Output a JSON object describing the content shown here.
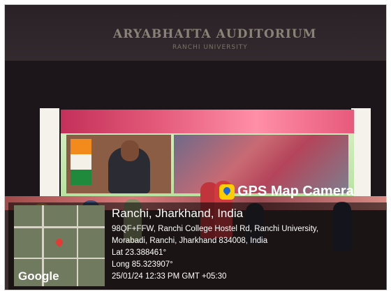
{
  "scene": {
    "wall_title": "ARYABHATTA AUDITORIUM",
    "wall_subtitle": "RANCHI UNIVERSITY"
  },
  "watermark": {
    "app_name": "GPS Map Camera",
    "map_logo": "Google",
    "location_title": "Ranchi, Jharkhand, India",
    "address_line1": "98QF+FFW, Ranchi College Hostel Rd, Ranchi University,",
    "address_line2": "Morabadi, Ranchi, Jharkhand 834008, India",
    "lat": "Lat 23.388461°",
    "long": "Long 85.323907°",
    "datetime": "25/01/24 12:33 PM GMT +05:30"
  }
}
